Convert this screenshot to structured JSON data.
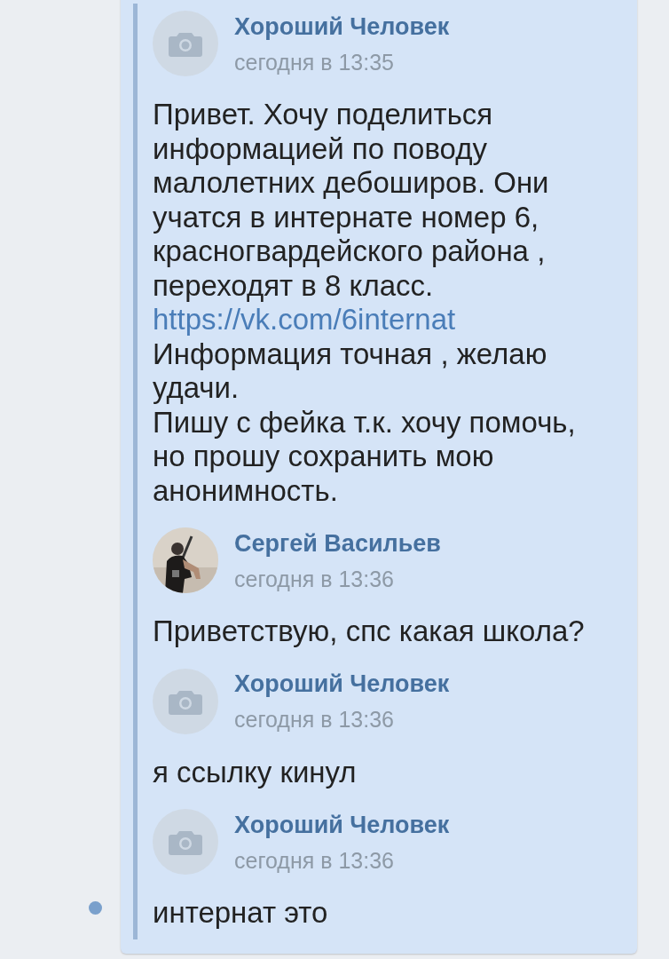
{
  "messages": [
    {
      "author": "Хороший Человек",
      "time": "сегодня в 13:35",
      "kind": "camera",
      "unread": false,
      "paragraphs": [
        {
          "kind": "text",
          "text": "Привет. Хочу поделиться информацией по поводу малолетних дебоширов. Они учатся в интернате номер 6, красногвардейского района , переходят в 8 класс."
        },
        {
          "kind": "link",
          "text": "https://vk.com/6internat"
        },
        {
          "kind": "text",
          "text": "Информация точная , желаю удачи."
        },
        {
          "kind": "text",
          "text": "Пишу с фейка т.к. хочу помочь, но прошу сохранить мою анонимность."
        }
      ]
    },
    {
      "author": "Сергей Васильев",
      "time": "сегодня в 13:36",
      "kind": "picture",
      "unread": false,
      "paragraphs": [
        {
          "kind": "text",
          "text": "Приветствую, спс какая школа?"
        }
      ]
    },
    {
      "author": "Хороший Человек",
      "time": "сегодня в 13:36",
      "kind": "camera",
      "unread": false,
      "paragraphs": [
        {
          "kind": "text",
          "text": "я ссылку кинул"
        }
      ]
    },
    {
      "author": "Хороший Человек",
      "time": "сегодня в 13:36",
      "kind": "camera",
      "unread": true,
      "paragraphs": [
        {
          "kind": "text",
          "text": "интернат это"
        }
      ]
    }
  ]
}
